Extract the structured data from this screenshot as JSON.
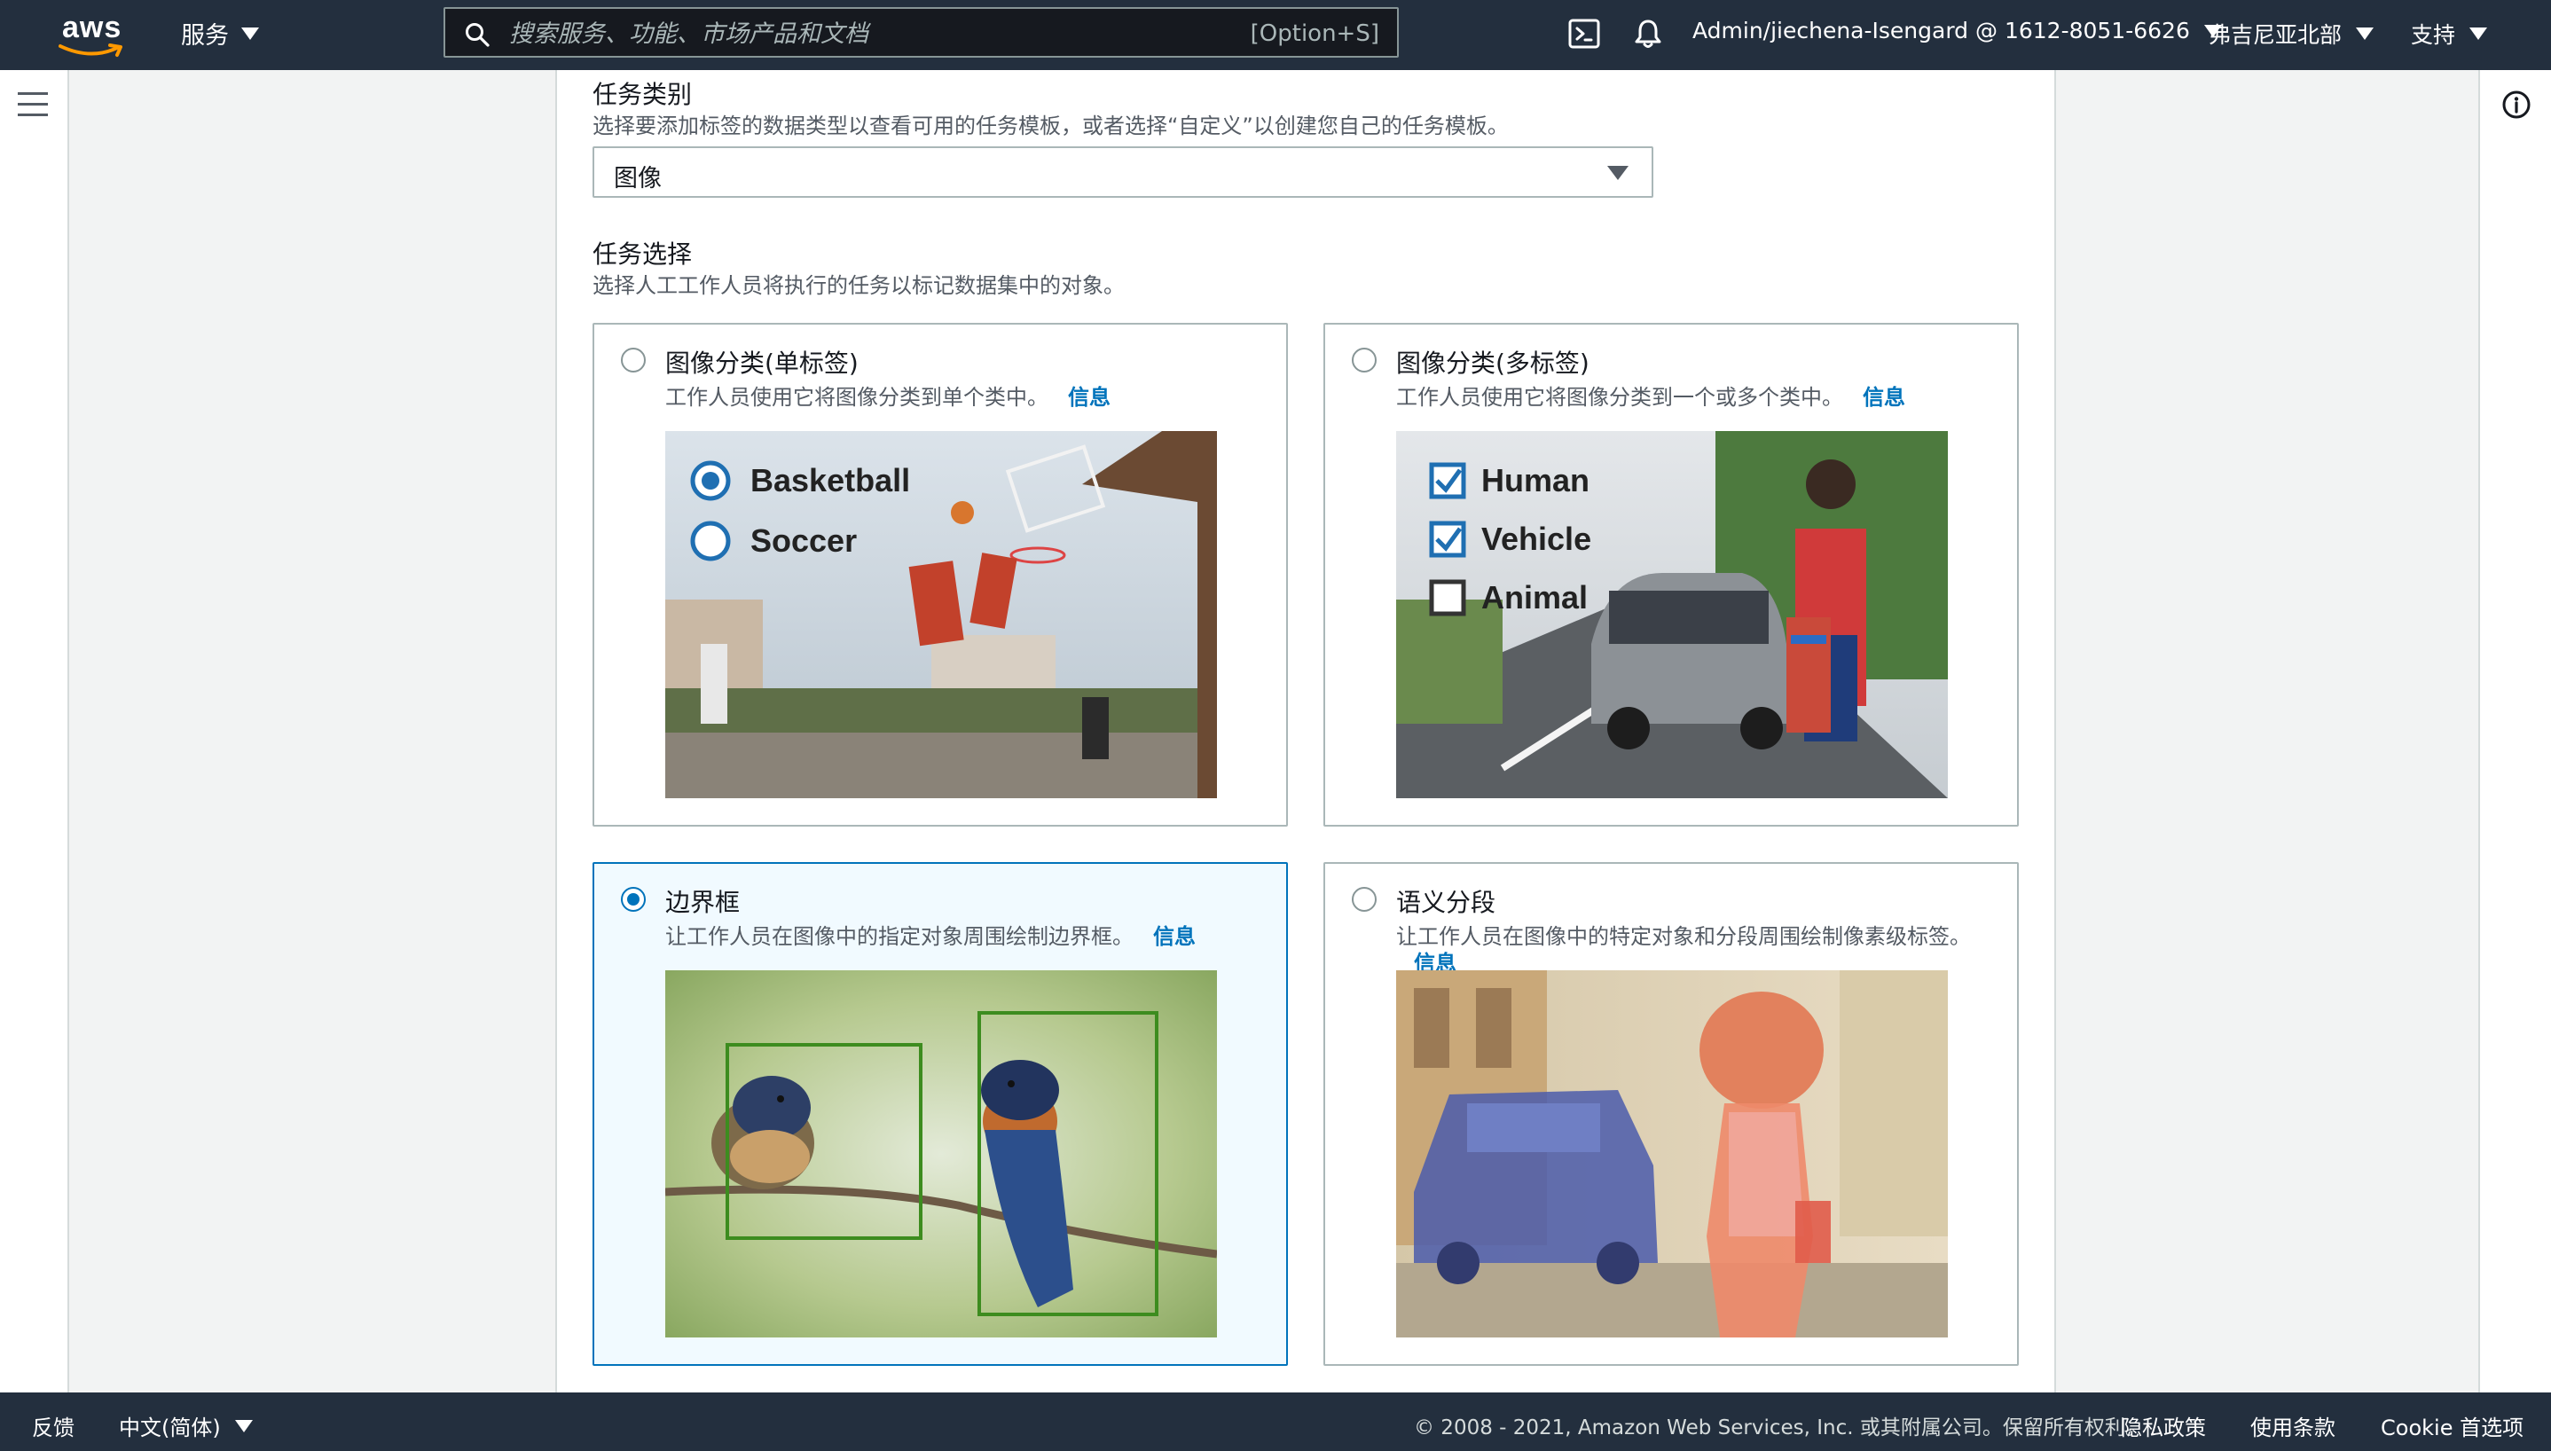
{
  "nav": {
    "logo_text": "aws",
    "services_label": "服务",
    "search_placeholder": "搜索服务、功能、市场产品和文档",
    "search_shortcut": "[Option+S]",
    "account_label": "Admin/jiechena-Isengard @ 1612-8051-6626",
    "region_label": "弗吉尼亚北部",
    "support_label": "支持",
    "icons": [
      "cloudshell-icon",
      "bell-icon"
    ]
  },
  "content": {
    "task_category": {
      "title": "任务类别",
      "description": "选择要添加标签的数据类型以查看可用的任务模板，或者选择“自定义”以创建您自己的任务模板。",
      "selected_value": "图像"
    },
    "task_selection": {
      "title": "任务选择",
      "description": "选择人工工作人员将执行的任务以标记数据集中的对象。",
      "cards": [
        {
          "title": "图像分类(单标签)",
          "description": "工作人员使用它将图像分类到单个类中。",
          "link": "信息",
          "selected": false,
          "image_labels": [
            "Basketball",
            "Soccer"
          ]
        },
        {
          "title": "图像分类(多标签)",
          "description": "工作人员使用它将图像分类到一个或多个类中。",
          "link": "信息",
          "selected": false,
          "image_labels": [
            "Human",
            "Vehicle",
            "Animal"
          ]
        },
        {
          "title": "边界框",
          "description": "让工作人员在图像中的指定对象周围绘制边界框。",
          "link": "信息",
          "selected": true
        },
        {
          "title": "语义分段",
          "description": "让工作人员在图像中的特定对象和分段周围绘制像素级标签。",
          "link": "信息",
          "selected": false
        }
      ]
    }
  },
  "footer": {
    "feedback": "反馈",
    "language": "中文(简体)",
    "copyright": "© 2008 - 2021, Amazon Web Services, Inc. 或其附属公司。保留所有权利。",
    "privacy": "隐私政策",
    "terms": "使用条款",
    "cookie": "Cookie 首选项"
  },
  "colors": {
    "nav_bg": "#232f3e",
    "accent": "#0073bb",
    "selected_bg": "#f1faff",
    "box_green": "#3d8c1f"
  }
}
